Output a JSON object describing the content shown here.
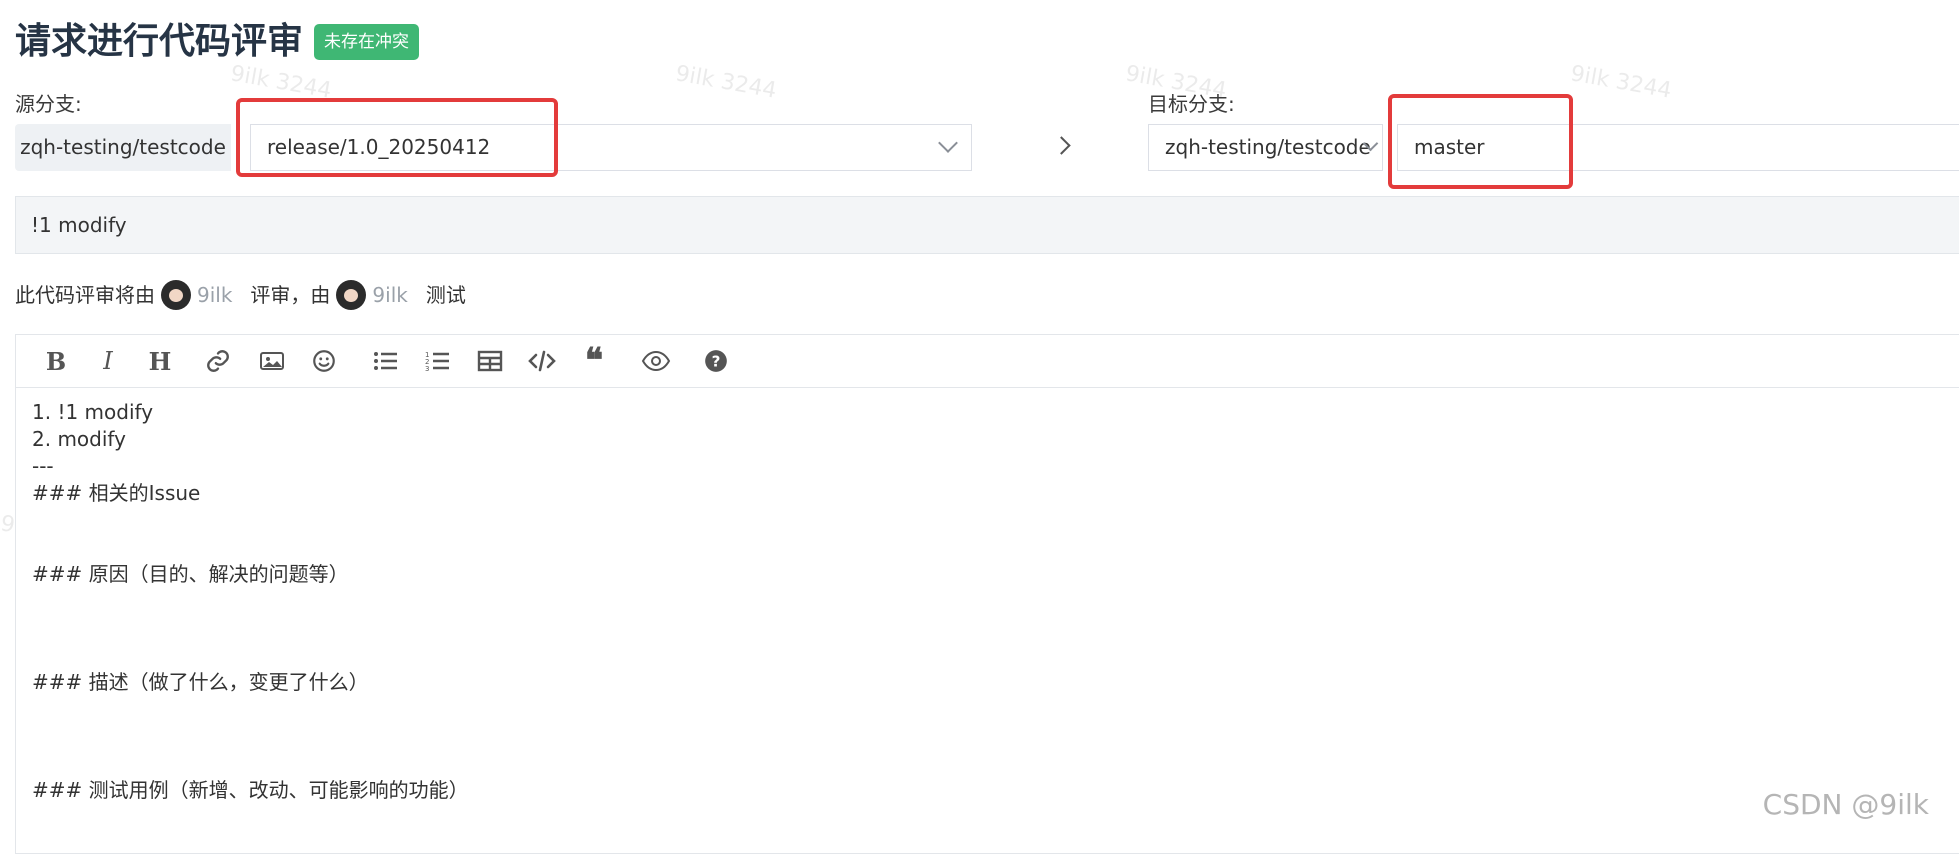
{
  "page": {
    "title": "请求进行代码评审",
    "badge": "未存在冲突"
  },
  "source": {
    "label": "源分支:",
    "repo": "zqh-testing/testcode",
    "branch": "release/1.0_20250412"
  },
  "target": {
    "label": "目标分支:",
    "repo": "zqh-testing/testcode",
    "branch": "master"
  },
  "pr": {
    "title": "!1 modify"
  },
  "review": {
    "prefix": "此代码评审将由",
    "reviewer": "9ilk",
    "mid": "评审，由",
    "tester": "9ilk",
    "suffix": "测试"
  },
  "toolbar": {
    "icons": [
      "bold-icon",
      "italic-icon",
      "heading-icon",
      "link-icon",
      "image-icon",
      "emoji-icon",
      "bullet-list-icon",
      "numbered-list-icon",
      "table-icon",
      "code-icon",
      "quote-icon",
      "preview-icon",
      "help-icon"
    ]
  },
  "editor": {
    "content": "1. !1 modify\n2. modify\n---\n### 相关的Issue\n\n\n### 原因（目的、解决的问题等）\n\n\n\n### 描述（做了什么，变更了什么）\n\n\n\n### 测试用例（新增、改动、可能影响的功能）"
  },
  "watermark": {
    "text": "9ilk 3244"
  },
  "footer": {
    "credit": "CSDN @9ilk"
  },
  "colors": {
    "badge": "#3fb774",
    "highlight": "#e33b3b",
    "title": "#263445"
  }
}
